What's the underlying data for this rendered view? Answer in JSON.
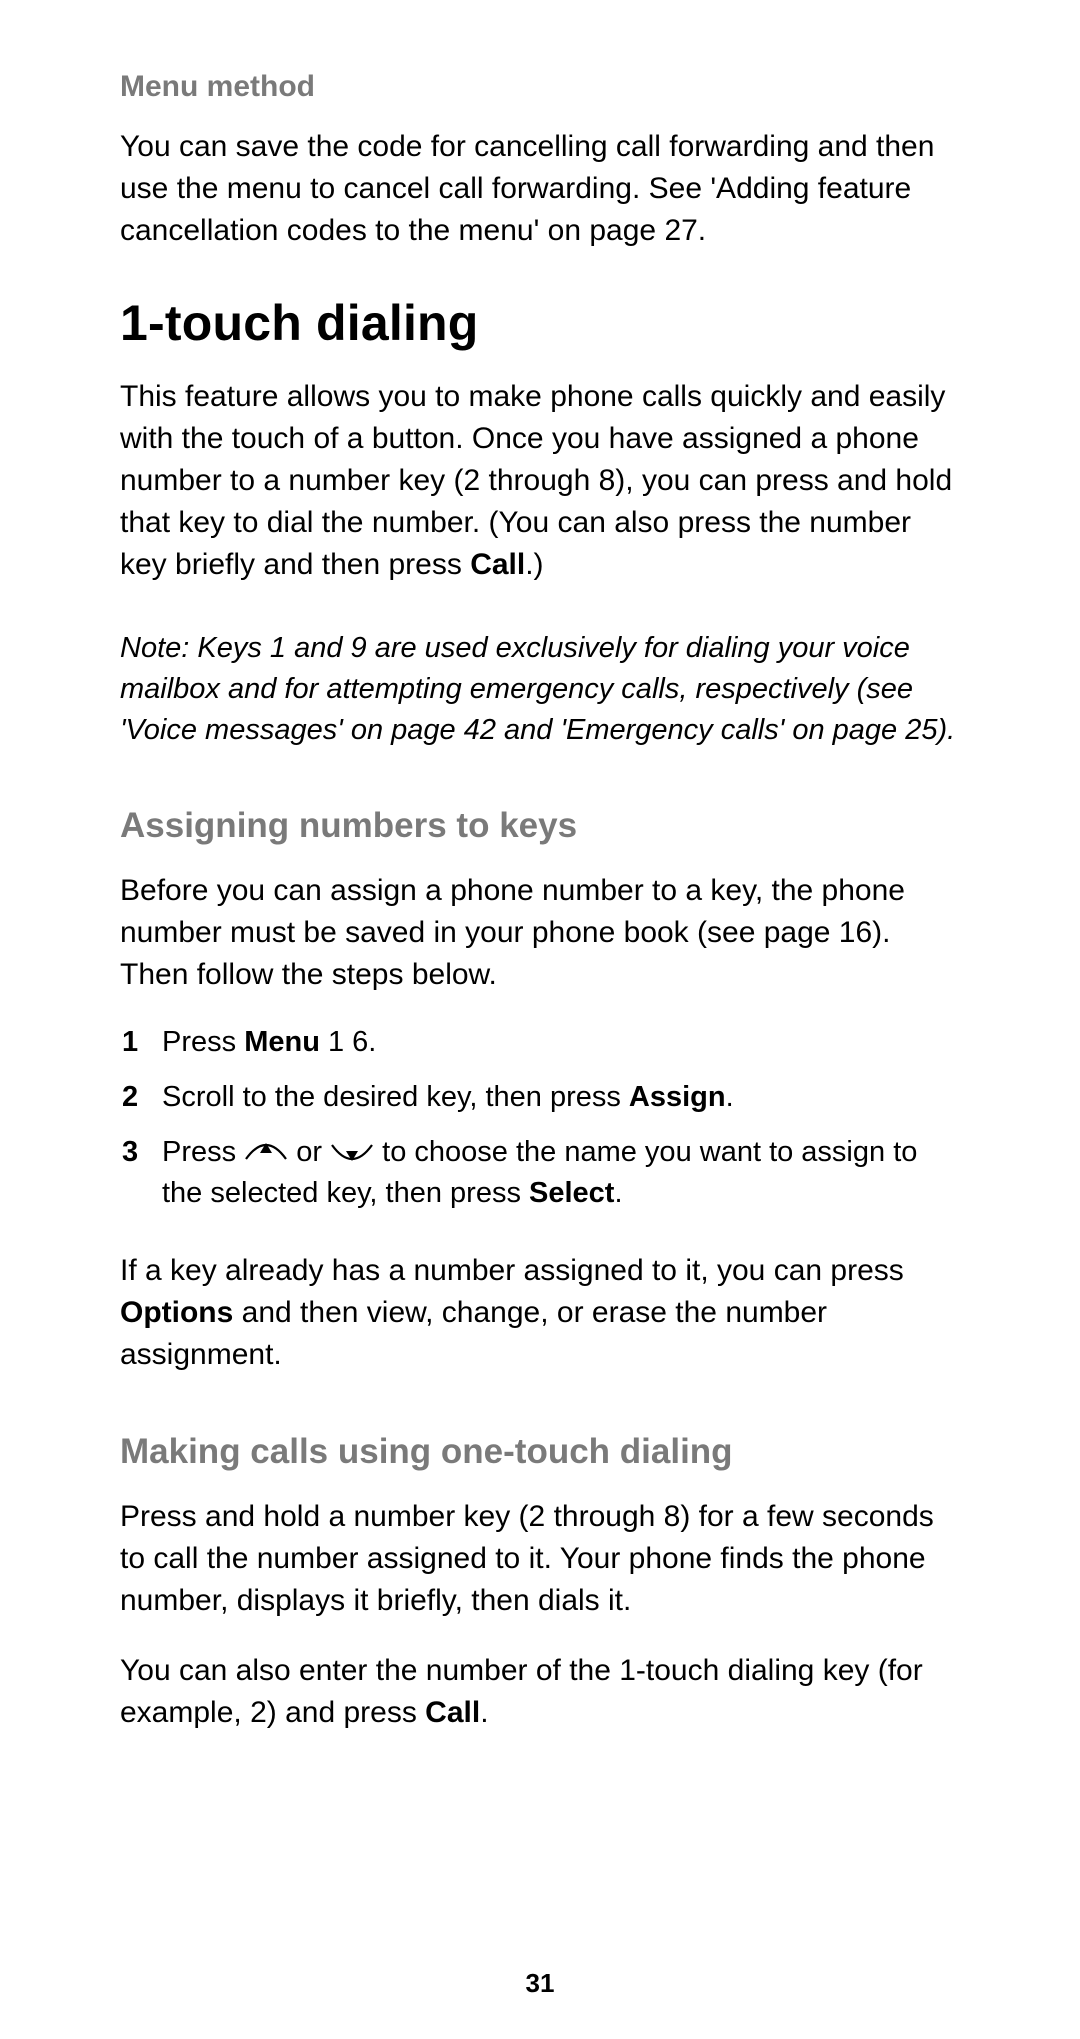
{
  "section_menu_method": {
    "heading": "Menu method",
    "body": "You can save the code for cancelling call forwarding and then use the menu to cancel call forwarding. See 'Adding feature cancellation codes to the menu' on page 27."
  },
  "h1": "1-touch dialing",
  "intro_p1_a": "This feature allows you to make phone calls quickly and easily with the touch of a button. Once you have assigned a phone number to a number key (2 through 8), you can press and hold that key to dial the number. (You can also press the number key briefly and then press ",
  "intro_p1_bold": "Call",
  "intro_p1_b": ".)",
  "note": "Note:  Keys 1 and 9 are used exclusively for dialing your voice mailbox and for attempting emergency calls, respectively (see 'Voice messages' on page 42 and 'Emergency calls' on page 25).",
  "assign": {
    "heading": "Assigning numbers to keys",
    "intro": "Before you can assign a phone number to a key, the phone number must be saved in your phone book (see page 16). Then follow the steps below.",
    "steps": [
      {
        "n": "1",
        "a": "Press ",
        "b1": "Menu",
        "c": " 1 6."
      },
      {
        "n": "2",
        "a": "Scroll to the desired key, then press ",
        "b1": "Assign",
        "c": "."
      },
      {
        "n": "3",
        "a": "Press ",
        "mid": " or ",
        "tail1": " to choose the name you want to assign to the selected key, then press ",
        "b1": "Select",
        "c": "."
      }
    ],
    "after_a": "If a key already has a number assigned to it, you can press ",
    "after_bold": "Options",
    "after_b": " and then view, change, or erase the number assignment."
  },
  "making": {
    "heading": "Making calls using one-touch dialing",
    "p1": "Press and hold a number key (2 through 8) for a few seconds to call the number assigned to it. Your phone finds the phone number, displays it briefly, then dials it.",
    "p2_a": "You can also enter the number of the 1-touch dialing key (for example, 2) and press ",
    "p2_bold": "Call",
    "p2_b": "."
  },
  "page_number": "31"
}
